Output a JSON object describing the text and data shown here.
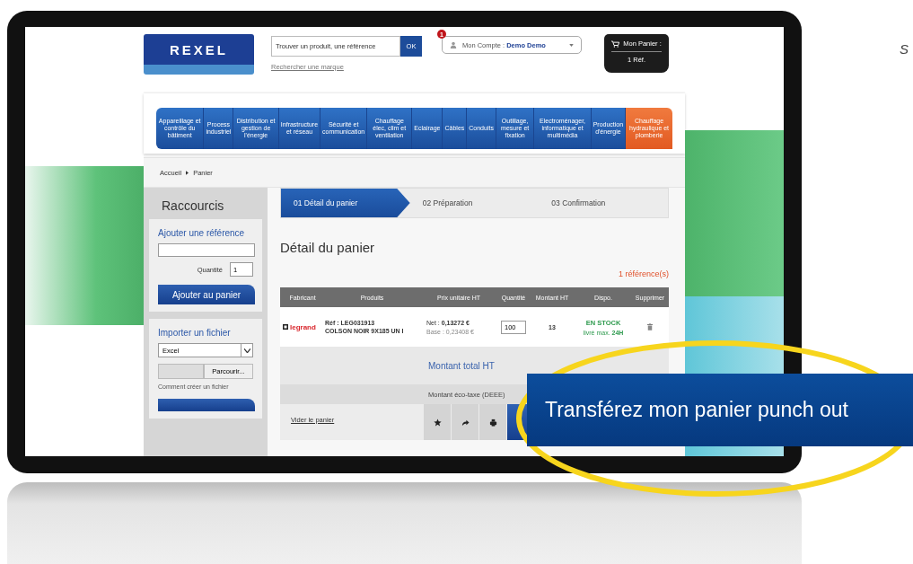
{
  "edge_text": "S",
  "header": {
    "logo": "REXEL",
    "search": {
      "placeholder": "Trouver un produit, une référence",
      "button": "OK",
      "link": "Rechercher une marque"
    },
    "account": {
      "badge": "1",
      "label": "Mon Compte : ",
      "name": "Demo Demo"
    },
    "cart": {
      "label": "Mon Panier :",
      "count": "1 Réf."
    }
  },
  "nav": [
    {
      "label": "Appareillage et contrôle du bâtiment",
      "selected": false
    },
    {
      "label": "Process industriel",
      "selected": false
    },
    {
      "label": "Distribution et gestion de l'énergie",
      "selected": false
    },
    {
      "label": "Infrastructure et réseau",
      "selected": false
    },
    {
      "label": "Sécurité et communication",
      "selected": false
    },
    {
      "label": "Chauffage élec, clim et ventilation",
      "selected": false
    },
    {
      "label": "Eclairage",
      "selected": false
    },
    {
      "label": "Câbles",
      "selected": false
    },
    {
      "label": "Conduits",
      "selected": false
    },
    {
      "label": "Outillage, mesure et fixation",
      "selected": false
    },
    {
      "label": "Electroménager, informatique et multimédia",
      "selected": false
    },
    {
      "label": "Production d'énergie",
      "selected": false
    },
    {
      "label": "Chauffage hydraulique et plomberie",
      "selected": true
    }
  ],
  "breadcrumb": [
    "Accueil",
    "Panier"
  ],
  "sidebar": {
    "title": "Raccourcis",
    "add_reference": {
      "heading": "Ajouter une référence",
      "quantity_label": "Quantité",
      "quantity": "1",
      "button": "Ajouter au panier"
    },
    "import_file": {
      "heading": "Importer un fichier",
      "format": "Excel",
      "browse": "Parcourir...",
      "help_link": "Comment créer un fichier"
    }
  },
  "steps": [
    {
      "label": "01 Détail du panier",
      "selected": true
    },
    {
      "label": "02 Préparation",
      "selected": false
    },
    {
      "label": "03 Confirmation",
      "selected": false
    }
  ],
  "title": "Détail du panier",
  "reference_count": "1 référence(s)",
  "table": {
    "columns": [
      "Fabricant",
      "Produits",
      "Prix unitaire HT",
      "Quantité",
      "Montant HT",
      "Dispo.",
      "Supprimer"
    ],
    "rows": [
      {
        "brand": "legrand",
        "reference": "Réf : LEG031913",
        "product": "COLSON NOIR 9X185 UN I",
        "net_price": "Net : **0,13272 €**",
        "base_price": "Base : 0,23408 €",
        "quantity": "100",
        "amount": "13",
        "stock": "EN STOCK",
        "delivery": "livré max. **24H**"
      }
    ]
  },
  "totals": {
    "total_label": "Montant total HT",
    "ecotax_label": "Montant éco-taxe (DEEE)"
  },
  "footer": {
    "clear_link": "Vider le panier"
  },
  "callout": "Transférez mon panier punch out"
}
